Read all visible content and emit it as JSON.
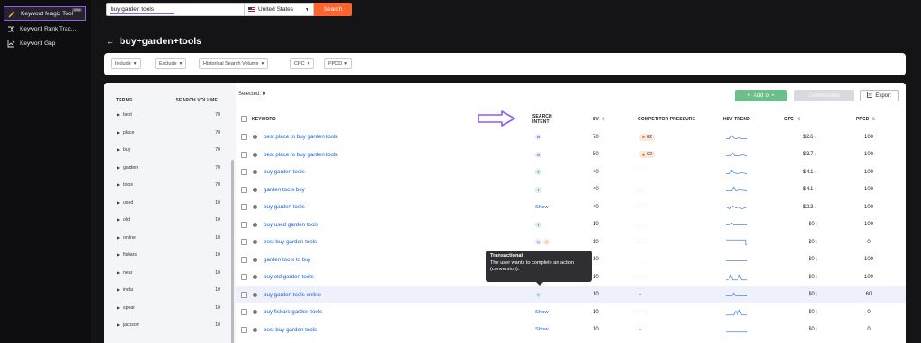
{
  "sidebar": {
    "items": [
      {
        "label": "Keyword Magic Tool",
        "badge": "beta",
        "icon": "wand-icon",
        "active": true
      },
      {
        "label": "Keyword Rank Trac...",
        "icon": "shuffle-icon",
        "active": false
      },
      {
        "label": "Keyword Gap",
        "icon": "chart-icon",
        "active": false
      }
    ]
  },
  "search": {
    "query": "buy garden tools",
    "database": "United States",
    "button": "Search"
  },
  "page_title": "buy+garden+tools",
  "back_icon": "←",
  "filters": [
    {
      "label": "Include"
    },
    {
      "label": "Exclude"
    },
    {
      "label": "Historical Search Volume"
    },
    {
      "label": "CPC"
    },
    {
      "label": "PPCD"
    }
  ],
  "left_panel": {
    "header_terms": "TERMS",
    "header_volume": "SEARCH VOLUME",
    "terms": [
      {
        "term": "best",
        "volume": "70"
      },
      {
        "term": "place",
        "volume": "70"
      },
      {
        "term": "buy",
        "volume": "70"
      },
      {
        "term": "garden",
        "volume": "70"
      },
      {
        "term": "tools",
        "volume": "70"
      },
      {
        "term": "used",
        "volume": "10"
      },
      {
        "term": "old",
        "volume": "10"
      },
      {
        "term": "online",
        "volume": "10"
      },
      {
        "term": "fiskars",
        "volume": "10"
      },
      {
        "term": "near",
        "volume": "10"
      },
      {
        "term": "india",
        "volume": "10"
      },
      {
        "term": "spear",
        "volume": "10"
      },
      {
        "term": "jackson",
        "volume": "10"
      }
    ]
  },
  "toolbar": {
    "selected_label": "Selected:",
    "selected_count": "0",
    "add_to": "Add to",
    "communities": "Communities",
    "export": "Export"
  },
  "table": {
    "headers": {
      "keyword": "KEYWORD",
      "intent_line1": "SEARCH",
      "intent_line2": "INTENT",
      "sv": "SV",
      "competitor": "COMPETITOR PRESSURE",
      "hsv": "HSV TREND",
      "cpc": "CPC",
      "ppcd": "PPCD"
    },
    "rows": [
      {
        "keyword": "best place to buy garden tools",
        "intent": [
          "N"
        ],
        "sv": "70",
        "cp": "62",
        "cpc": "$2.6",
        "cpc_trend": "down",
        "ppcd": "100"
      },
      {
        "keyword": "best place to buy garden tools",
        "intent": [
          "N"
        ],
        "sv": "50",
        "cp": "62",
        "cpc": "$3.7",
        "cpc_trend": "down",
        "ppcd": "100"
      },
      {
        "keyword": "buy garden tools",
        "intent": [
          "T"
        ],
        "sv": "40",
        "cp": "-",
        "cpc": "$4.1",
        "cpc_trend": "down",
        "ppcd": "100"
      },
      {
        "keyword": "garden tools buy",
        "intent": [
          "T"
        ],
        "sv": "40",
        "cp": "-",
        "cpc": "$4.1",
        "cpc_trend": "down",
        "ppcd": "100"
      },
      {
        "keyword": "buy garden tools",
        "intent_show": "Show",
        "sv": "40",
        "cp": "-",
        "cpc": "$2.3",
        "cpc_trend": "down",
        "ppcd": "100"
      },
      {
        "keyword": "buy used garden tools",
        "intent": [
          "T"
        ],
        "sv": "10",
        "cp": "-",
        "cpc": "$0",
        "cpc_trend": "flat",
        "ppcd": "100"
      },
      {
        "keyword": "best buy garden tools",
        "intent": [
          "N",
          "C"
        ],
        "sv": "10",
        "cp": "-",
        "cpc": "$0",
        "cpc_trend": "flat",
        "ppcd": "0"
      },
      {
        "keyword": "garden tools to buy",
        "intent": [],
        "sv": "10",
        "cp": "-",
        "cpc": "$0",
        "cpc_trend": "flat",
        "ppcd": "100"
      },
      {
        "keyword": "buy old garden tools",
        "intent": [],
        "sv": "10",
        "cp": "-",
        "cpc": "$0",
        "cpc_trend": "flat",
        "ppcd": "100"
      },
      {
        "keyword": "buy garden tools online",
        "intent": [
          "T"
        ],
        "sv": "10",
        "cp": "-",
        "cpc": "$0",
        "cpc_trend": "flat",
        "ppcd": "60"
      },
      {
        "keyword": "buy fiskars garden tools",
        "intent_show": "Show",
        "sv": "10",
        "cp": "-",
        "cpc": "$0",
        "cpc_trend": "flat",
        "ppcd": "0"
      },
      {
        "keyword": "best buy garden tools",
        "intent_show": "Show",
        "sv": "10",
        "cp": "-",
        "cpc": "$0",
        "cpc_trend": "flat",
        "ppcd": "0"
      }
    ]
  },
  "tooltip": {
    "title": "Transactional",
    "body": "The user wants to complete an action (conversion)."
  },
  "colors": {
    "accent": "#8b5cf6",
    "search_button": "#ff642d",
    "link": "#1a5fd0",
    "add_button": "#6cbf8a"
  }
}
